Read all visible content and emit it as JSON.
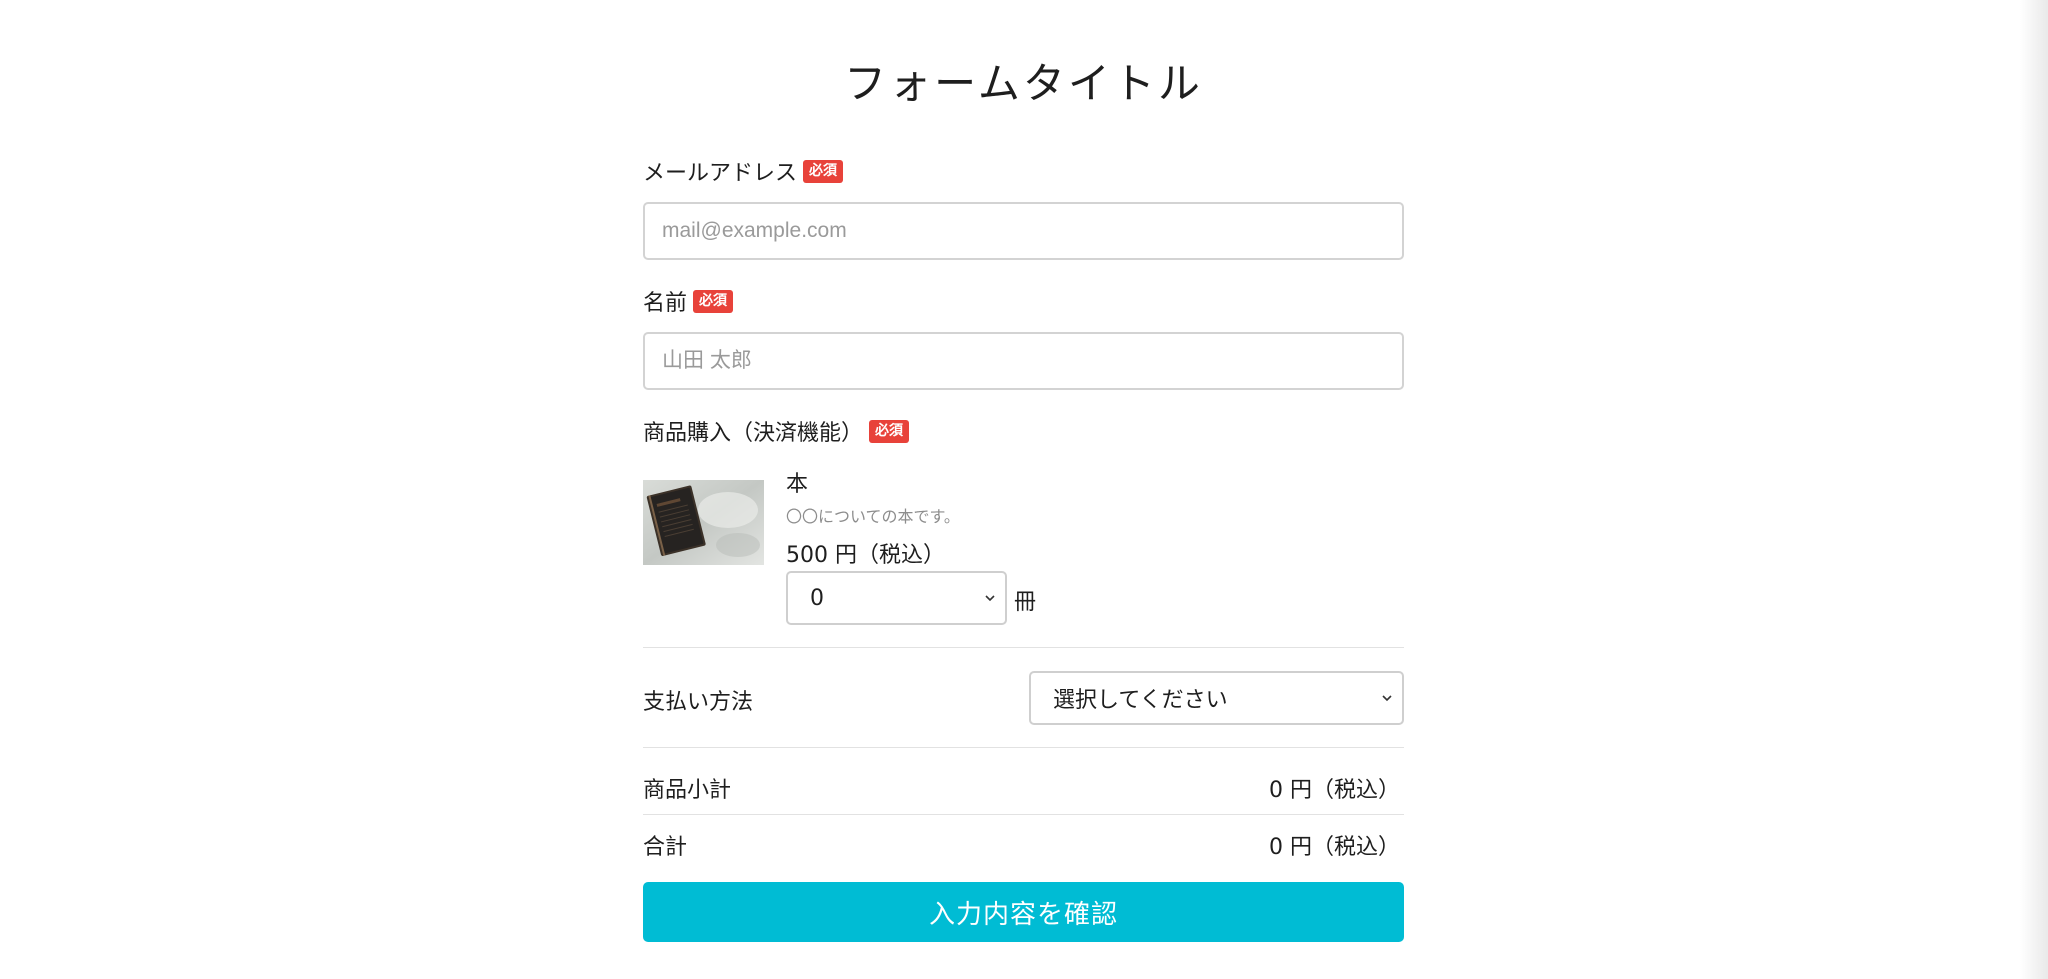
{
  "form": {
    "title": "フォームタイトル",
    "email": {
      "label": "メールアドレス",
      "badge": "必須",
      "placeholder": "mail@example.com",
      "value": ""
    },
    "name": {
      "label": "名前",
      "badge": "必須",
      "placeholder": "山田 太郎",
      "value": ""
    },
    "purchase": {
      "label": "商品購入（決済機能）",
      "badge": "必須",
      "product": {
        "name": "本",
        "description": "〇〇についての本です。",
        "price": "500 円（税込）",
        "image_icon": "book-image",
        "quantity_selected": "0",
        "quantity_unit": "冊"
      }
    },
    "payment": {
      "label": "支払い方法",
      "selected": "選択してください"
    },
    "subtotal": {
      "label": "商品小計",
      "value": "0 円（税込）"
    },
    "total": {
      "label": "合計",
      "value": "0 円（税込）"
    },
    "submit_label": "入力内容を確認"
  },
  "colors": {
    "required_badge": "#e8423a",
    "submit_button": "#00bcd4"
  }
}
